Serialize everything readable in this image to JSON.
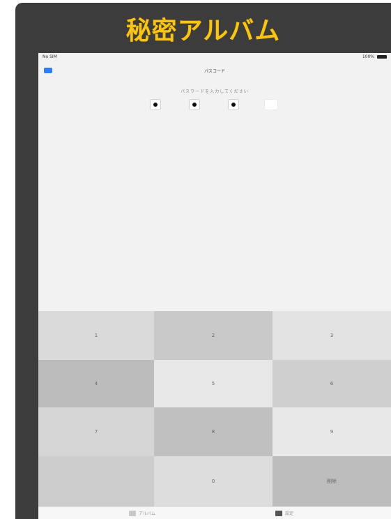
{
  "banner": {
    "title": "秘密アルバム",
    "color": "#f7c51a"
  },
  "status_bar": {
    "carrier": "No SIM",
    "battery": "100%"
  },
  "nav": {
    "title": "パスコード"
  },
  "passcode": {
    "prompt": "パスワードを入力してください",
    "entered_count": 3,
    "length": 4
  },
  "keypad": {
    "keys": [
      "1",
      "2",
      "3",
      "4",
      "5",
      "6",
      "7",
      "8",
      "9",
      "",
      "0",
      "削除"
    ],
    "colors": [
      "#dadada",
      "#c9c9c9",
      "#e3e3e3",
      "#bcbcbc",
      "#e7e7e7",
      "#cfcfcf",
      "#d6d6d6",
      "#c0c0c0",
      "#e8e8e8",
      "#cdcdcd",
      "#dddddd",
      "#bdbdbd"
    ]
  },
  "tabs": [
    {
      "label": "アルバム",
      "icon": "album-icon"
    },
    {
      "label": "設定",
      "icon": "settings-icon"
    }
  ]
}
